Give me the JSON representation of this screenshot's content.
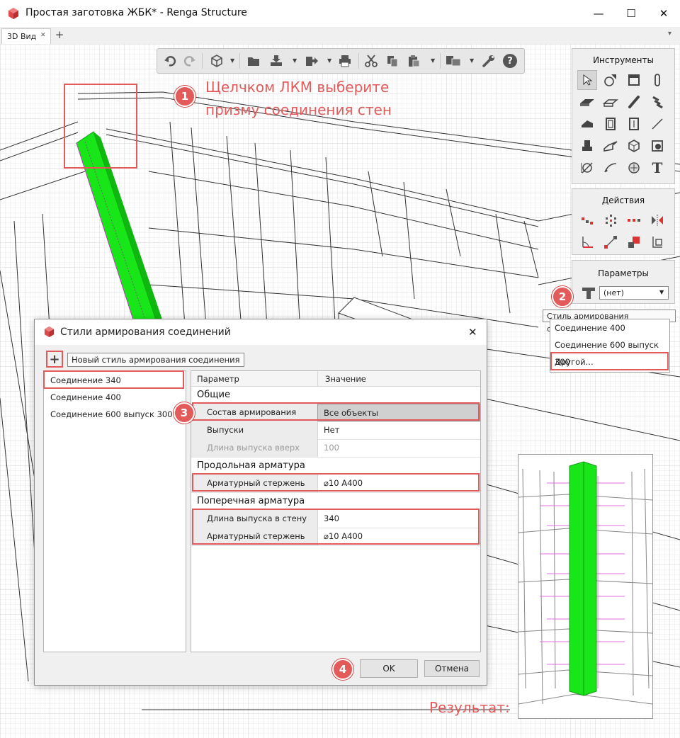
{
  "window": {
    "title": "Простая заготовка ЖБК* - Renga Structure",
    "minimize": "—",
    "maximize": "☐",
    "close": "✕"
  },
  "tabs": {
    "items": [
      {
        "label": "3D Вид",
        "close": "✕"
      }
    ],
    "add": "+",
    "overflow": "▾"
  },
  "toolbar": {
    "icons": [
      "undo-icon",
      "redo-icon",
      "view-cube-icon",
      "open-folder-icon",
      "import-icon",
      "export-icon",
      "print-icon",
      "cut-icon",
      "paste-icon",
      "display-settings-icon",
      "settings-wrench-icon",
      "help-icon"
    ],
    "help_glyph": "?"
  },
  "panels": {
    "tools_title": "Инструменты",
    "actions_title": "Действия",
    "params_title": "Параметры",
    "param_style_value": "(нет)",
    "tool_text_glyph": "T"
  },
  "tooltip": {
    "text": "Стиль армирования соединения"
  },
  "dropdown": {
    "items": [
      "Соединение 400",
      "Соединение 600 выпуск 300",
      "Другой..."
    ]
  },
  "annotations": {
    "step1_text_line1": "Щелчком ЛКМ выберите",
    "step1_text_line2": "призму соединения стен",
    "badges": [
      "1",
      "2",
      "3",
      "4"
    ],
    "result_label": "Результат:"
  },
  "dialog": {
    "title": "Стили армирования соединений",
    "close": "✕",
    "add_glyph": "+",
    "new_style_hint": "Новый стиль армирования соединения",
    "styles": [
      "Соединение 340",
      "Соединение 400",
      "Соединение 600 выпуск 300"
    ],
    "selected_style": "Соединение 340",
    "grid": {
      "col_param": "Параметр",
      "col_value": "Значение",
      "groups": {
        "general": "Общие",
        "longitudinal": "Продольная арматура",
        "transverse": "Поперечная арматура"
      },
      "rows": {
        "composition": {
          "name": "Состав армирования",
          "value": "Все объекты"
        },
        "outlets": {
          "name": "Выпуски",
          "value": "Нет"
        },
        "outlet_up": {
          "name": "Длина выпуска вверх",
          "value": "100"
        },
        "long_bar": {
          "name": "Арматурный стержень",
          "value": "⌀10 A400"
        },
        "wall_len": {
          "name": "Длина выпуска в стену",
          "value": "340"
        },
        "trans_bar": {
          "name": "Арматурный стержень",
          "value": "⌀10 A400"
        }
      }
    },
    "ok": "OK",
    "cancel": "Отмена"
  },
  "colors": {
    "accent_red": "#e35a5a",
    "prism_green": "#19e619",
    "rebar_magenta": "#e070e0"
  }
}
